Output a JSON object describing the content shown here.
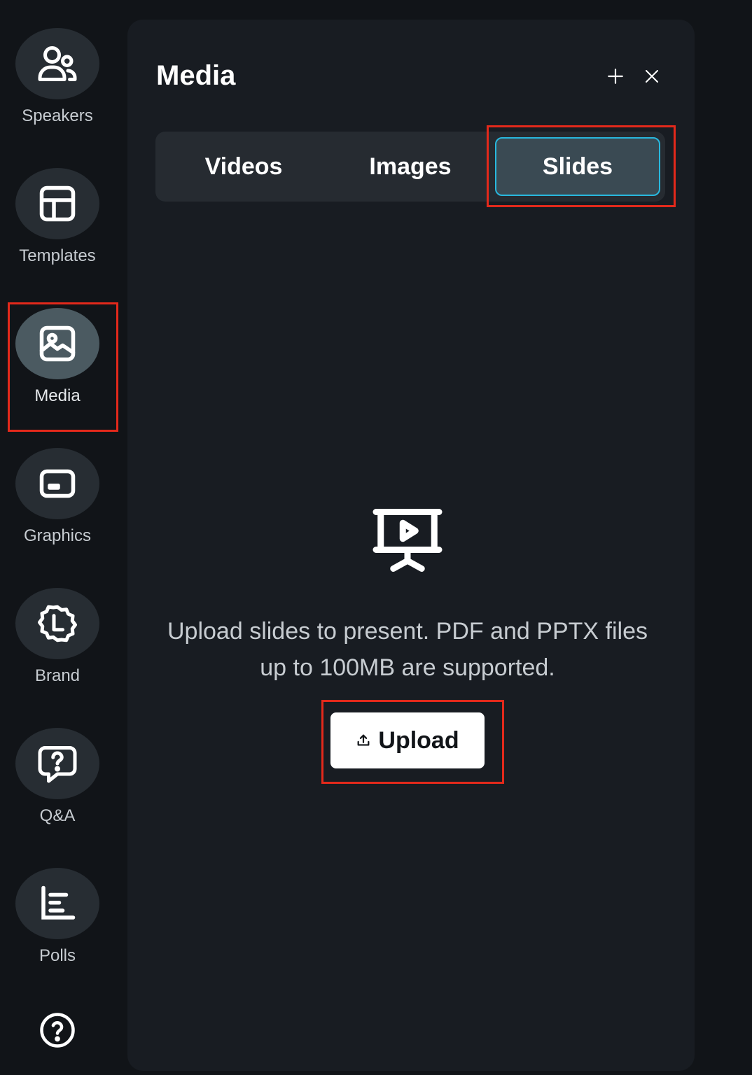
{
  "sidebar": {
    "items": [
      {
        "label": "Speakers",
        "icon": "users-icon"
      },
      {
        "label": "Templates",
        "icon": "layout-icon"
      },
      {
        "label": "Media",
        "icon": "image-icon",
        "active": true
      },
      {
        "label": "Graphics",
        "icon": "graphics-icon"
      },
      {
        "label": "Brand",
        "icon": "brand-badge-icon"
      },
      {
        "label": "Q&A",
        "icon": "question-chat-icon"
      },
      {
        "label": "Polls",
        "icon": "chart-icon"
      }
    ],
    "help_icon": "help-circle-icon"
  },
  "panel": {
    "title": "Media",
    "tabs": [
      {
        "label": "Videos"
      },
      {
        "label": "Images"
      },
      {
        "label": "Slides",
        "selected": true
      }
    ],
    "empty_state": {
      "icon": "presentation-icon",
      "text": "Upload slides to present. PDF and PPTX files up to 100MB are supported."
    },
    "upload_label": "Upload"
  },
  "colors": {
    "background": "#111418",
    "panel": "#181c22",
    "tab_active_border": "#28b8de",
    "highlight": "#e3291b"
  }
}
